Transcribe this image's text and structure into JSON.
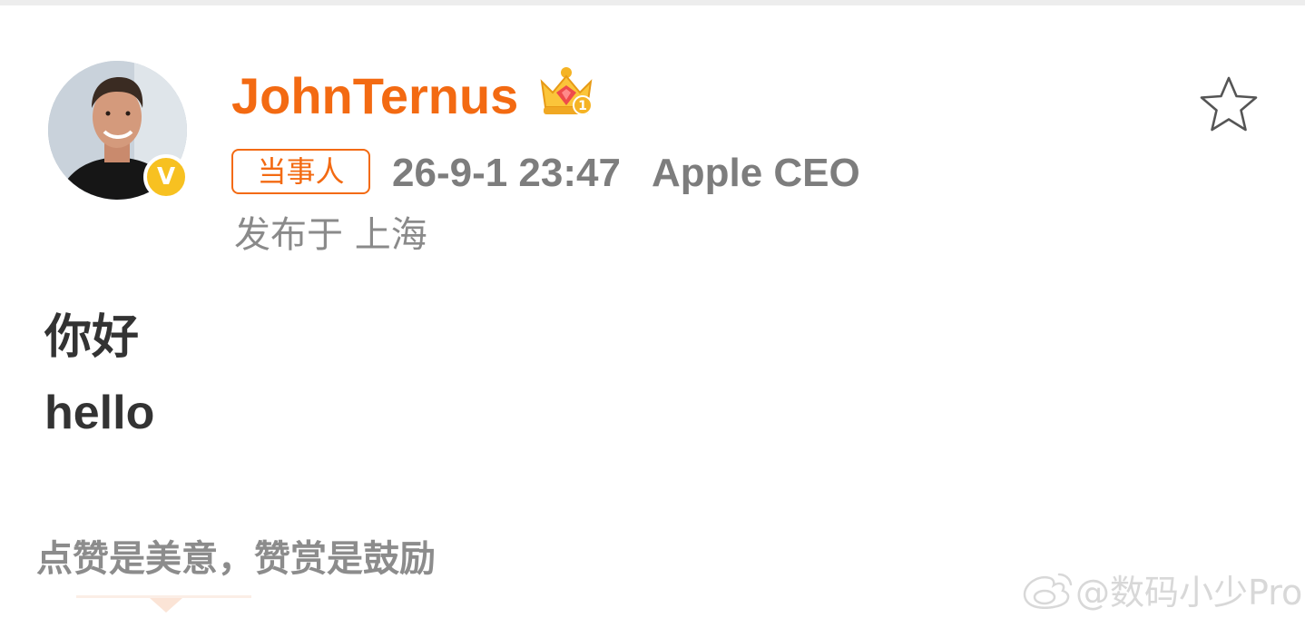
{
  "post": {
    "author": {
      "name": "JohnTernus",
      "verified": true,
      "verified_mark": "V",
      "rank_icon": "crown-icon",
      "rank_level": "1"
    },
    "tag": "当事人",
    "timestamp": "26-9-1 23:47",
    "author_title": "Apple CEO",
    "location": "发布于 上海",
    "content": [
      "你好",
      "hello"
    ],
    "reward_text": "点赞是美意，赞赏是鼓励",
    "favorite_icon": "star-icon"
  },
  "watermark": {
    "text": "@数码小少Pro",
    "icon": "weibo-icon"
  },
  "colors": {
    "accent": "#f36a12",
    "meta_text": "#7d7d7d",
    "body_text": "#333333",
    "verified_badge": "#f7c121"
  }
}
